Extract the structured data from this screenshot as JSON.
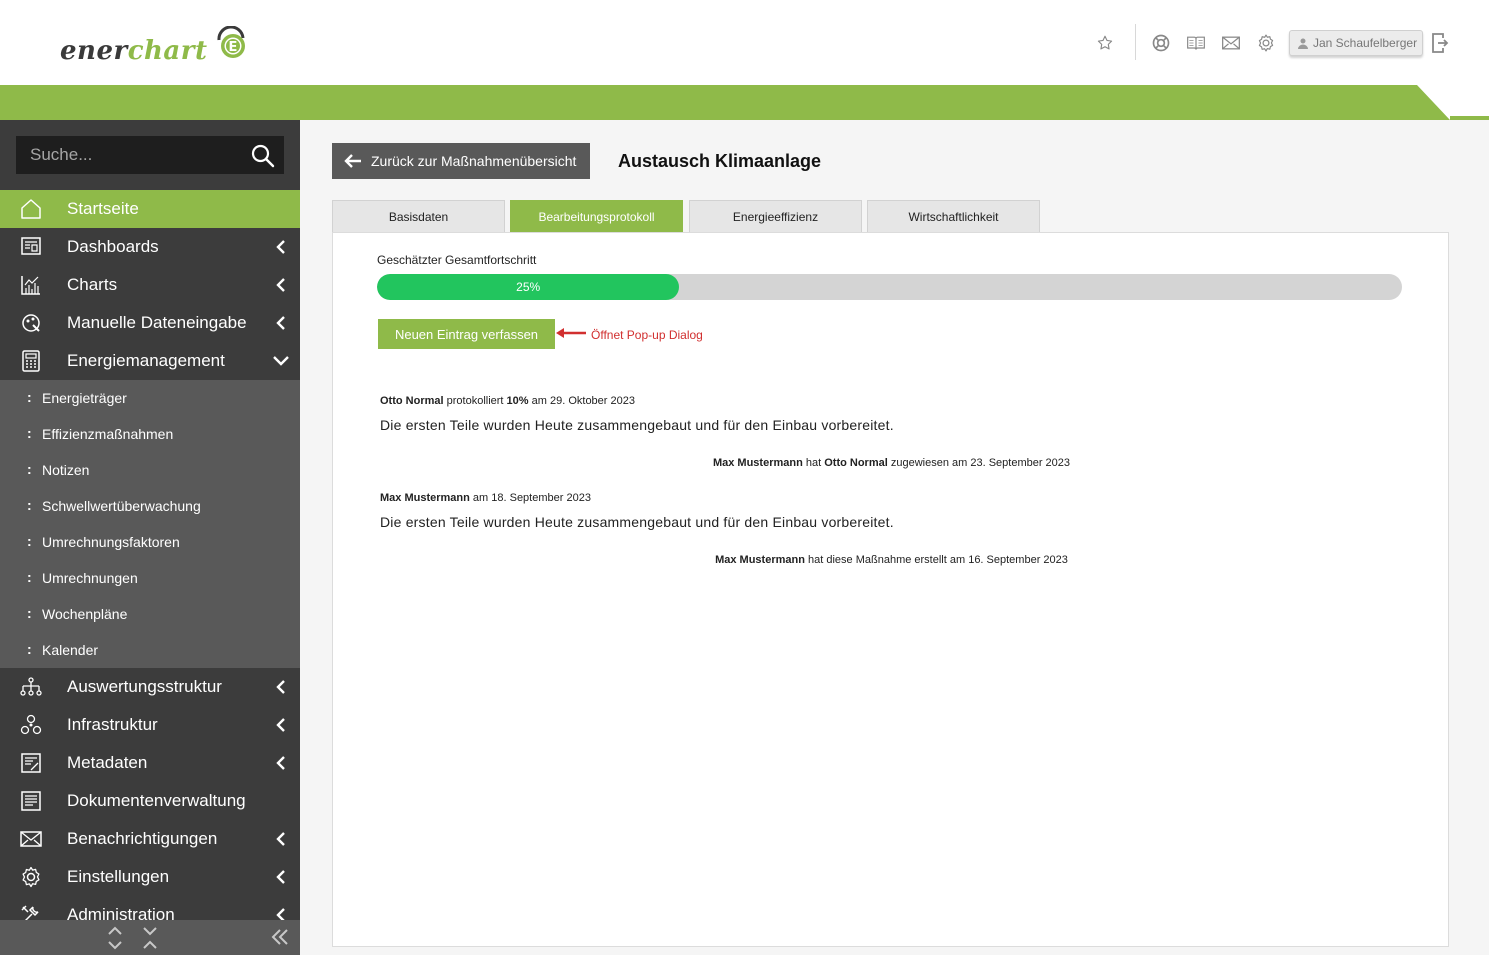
{
  "logo": {
    "part1": "ener",
    "part2": "chart",
    "mark": "E"
  },
  "header": {
    "icons": [
      "star-icon",
      "help-ring-icon",
      "book-icon",
      "mail-icon",
      "gear-icon",
      "logout-icon"
    ],
    "user_name": "Jan Schaufelberger"
  },
  "colors": {
    "brand_green": "#8fba49",
    "progress_green": "#22c55e",
    "sidebar_dark": "#3c3c3c",
    "sidebar_sub": "#595959",
    "annotation_red": "#d12f2f"
  },
  "sidebar": {
    "search_placeholder": "Suche...",
    "items": [
      {
        "label": "Startseite",
        "icon": "home-icon",
        "active": true
      },
      {
        "label": "Dashboards",
        "icon": "dashboard-icon",
        "chevron": "left"
      },
      {
        "label": "Charts",
        "icon": "chart-icon",
        "chevron": "left"
      },
      {
        "label": "Manuelle Dateneingabe",
        "icon": "data-entry-icon",
        "chevron": "left"
      },
      {
        "label": "Energiemanagement",
        "icon": "calculator-icon",
        "chevron": "down"
      },
      {
        "label": "Auswertungsstruktur",
        "icon": "structure-icon",
        "chevron": "left"
      },
      {
        "label": "Infrastruktur",
        "icon": "infrastructure-icon",
        "chevron": "left"
      },
      {
        "label": "Metadaten",
        "icon": "metadata-icon",
        "chevron": "left"
      },
      {
        "label": "Dokumentenverwaltung",
        "icon": "document-icon"
      },
      {
        "label": "Benachrichtigungen",
        "icon": "mail-icon",
        "chevron": "left"
      },
      {
        "label": "Einstellungen",
        "icon": "gear-icon",
        "chevron": "left"
      },
      {
        "label": "Administration",
        "icon": "tools-icon",
        "chevron": "left"
      }
    ],
    "subitems": [
      "Energieträger",
      "Effizienzmaßnahmen",
      "Notizen",
      "Schwellwertüberwachung",
      "Umrechnungsfaktoren",
      "Umrechnungen",
      "Wochenpläne",
      "Kalender"
    ]
  },
  "main": {
    "back_label": "Zurück zur Maßnahmenübersicht",
    "title": "Austausch Klimaanlage",
    "tabs": [
      "Basisdaten",
      "Bearbeitungsprotokoll",
      "Energieeffizienz",
      "Wirtschaftlichkeit"
    ],
    "active_tab": 1,
    "progress_label": "Geschätzter Gesamtfortschritt",
    "progress_value": 25,
    "progress_text": "25%",
    "new_entry_label": "Neuen Eintrag verfassen",
    "annotation": "Öffnet Pop-up Dialog",
    "entries": [
      {
        "author": "Otto Normal",
        "verb": "protokolliert",
        "percent": "10%",
        "date_text": "am 29. Oktober 2023",
        "body": "Die ersten Teile wurden Heute zusammengebaut und für den Einbau vorbereitet."
      },
      {
        "author": "Max Mustermann",
        "date_text": "am 18. September 2023",
        "body": "Die ersten Teile wurden Heute zusammengebaut und für den Einbau vorbereitet."
      }
    ],
    "system_lines": [
      {
        "actor": "Max Mustermann",
        "mid": "hat",
        "target": "Otto Normal",
        "rest": "zugewiesen am 23. September 2023"
      },
      {
        "actor": "Max Mustermann",
        "rest": "hat diese Maßnahme erstellt am 16. September 2023"
      }
    ]
  }
}
